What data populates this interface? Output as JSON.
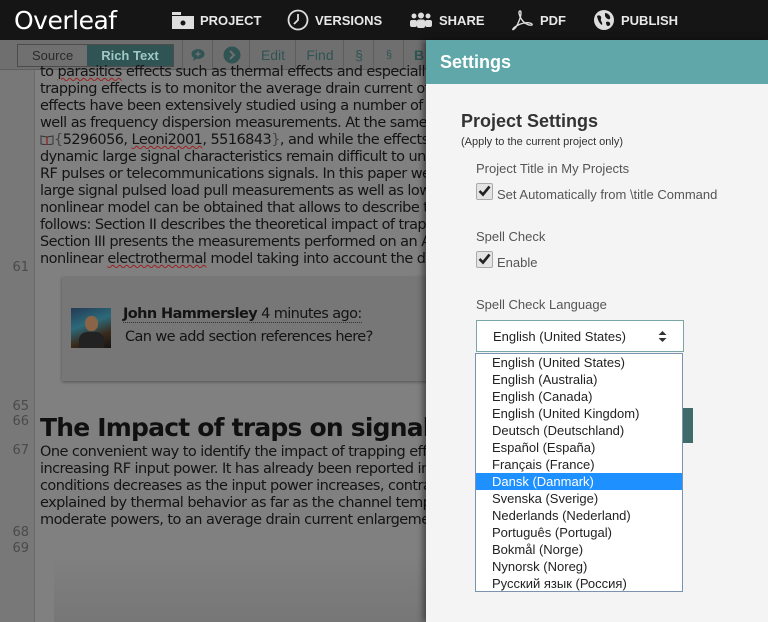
{
  "app": {
    "logo_text": "Overleaf"
  },
  "nav": {
    "items": [
      {
        "id": "project",
        "label": "PROJECT",
        "icon": "folder-icon"
      },
      {
        "id": "versions",
        "label": "VERSIONS",
        "icon": "clock-icon"
      },
      {
        "id": "share",
        "label": "SHARE",
        "icon": "users-icon"
      },
      {
        "id": "pdf",
        "label": "PDF",
        "icon": "pdf-icon"
      },
      {
        "id": "publish",
        "label": "PUBLISH",
        "icon": "globe-icon"
      }
    ]
  },
  "toolbar": {
    "source_label": "Source",
    "rich_text_label": "Rich Text",
    "comment_icon": "comment-add-icon",
    "next_icon": "chevron-right-icon",
    "edit_label": "Edit",
    "find_label": "Find",
    "section_label": "§",
    "subsection_label": "§",
    "bold_label": "B"
  },
  "editor": {
    "paragraph_lines": [
      "to parasitics effects such as thermal effects and especially",
      "trapping effects is to monitor the average drain current of",
      "effects have been extensively studied using a number of te",
      "well as frequency dispersion measurements. At the same t",
      "{5296056, Leoni2001, 5516843}, and while the effects of",
      "dynamic large signal characteristics remain difficult to un",
      "RF pulses or telecommunications signals. In this paper we",
      "large signal pulsed load pull measurements as well as low",
      "nonlinear model can be obtained that allows to describe t",
      "follows: Section II describes the theoretical impact of trap",
      "Section III presents the measurements performed on an A",
      "nonlinear electrothermal model taking into account the d"
    ],
    "citation": {
      "open": "{",
      "keys": "5296056, Leoni2001, 5516843",
      "close": "}",
      "after": ", and while the effects of"
    },
    "line_numbers": [
      "61",
      "65",
      "66",
      "67",
      "68",
      "69"
    ],
    "comment": {
      "author": "John Hammersley",
      "time": "4 minutes ago:",
      "text": "Can we add section references here?"
    },
    "heading": "The Impact of traps on signal c",
    "paragraph2_lines": [
      "One convenient way to identify the impact of trapping effe",
      "increasing RF input power. It has already been reported in",
      "conditions decreases as the input power increases, contra",
      "explained by thermal behavior as far as the channel temp",
      "moderate powers, to an average drain current enlargemen"
    ]
  },
  "settings": {
    "header": "Settings",
    "project_settings_title": "Project Settings",
    "project_settings_sub": "(Apply to the current project only)",
    "project_title_label": "Project Title in My Projects",
    "auto_title_label": "Set Automatically from \\title Command",
    "auto_title_checked": true,
    "spell_check_label": "Spell Check",
    "spell_enable_label": "Enable",
    "spell_enabled": true,
    "spell_language_label": "Spell Check Language",
    "spell_language_value": "English (United States)",
    "language_options": [
      "English (United States)",
      "English (Australia)",
      "English (Canada)",
      "English (United Kingdom)",
      "Deutsch (Deutschland)",
      "Español (España)",
      "Français (France)",
      "Dansk (Danmark)",
      "Svenska (Sverige)",
      "Nederlands (Nederland)",
      "Português (Portugal)",
      "Bokmål (Norge)",
      "Nynorsk (Noreg)",
      "Русский язык (Россия)"
    ],
    "highlighted_option": "Dansk (Danmark)"
  },
  "colors": {
    "accent": "#5fa7a8",
    "accent_dark": "#2f5453",
    "nav_bg": "#151515",
    "selection": "#1e90ff"
  }
}
